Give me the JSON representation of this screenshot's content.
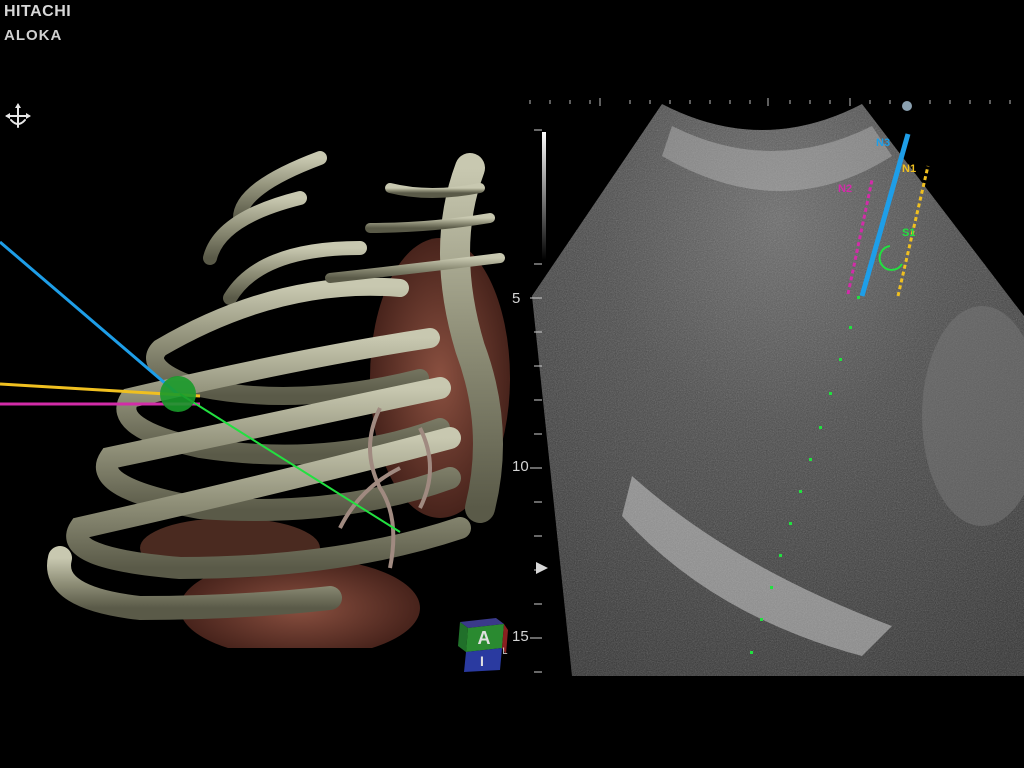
{
  "brand": {
    "line1": "HITACHI",
    "line2": "ALOKA"
  },
  "icons": {
    "navigation": "move-cursor-icon",
    "orientation_cube": "orientation-cube-icon",
    "focus_marker": "focus-marker-icon"
  },
  "orientation": {
    "front": "A",
    "bottom": "I",
    "side": "L"
  },
  "depth_scale": {
    "labels": [
      "5",
      "10",
      "15"
    ]
  },
  "needles": [
    {
      "label": "N3",
      "color": "#1e9ee8"
    },
    {
      "label": "N2",
      "color": "#d22ca8"
    },
    {
      "label": "N1",
      "color": "#f0c020"
    },
    {
      "label": "S1",
      "color": "#18c030"
    }
  ],
  "colors": {
    "needle_blue": "#1e9ee8",
    "needle_magenta": "#d22ca8",
    "needle_yellow": "#f0c020",
    "guide_green": "#22e040",
    "bone": "#a8a890",
    "tissue": "#6a3a30"
  }
}
